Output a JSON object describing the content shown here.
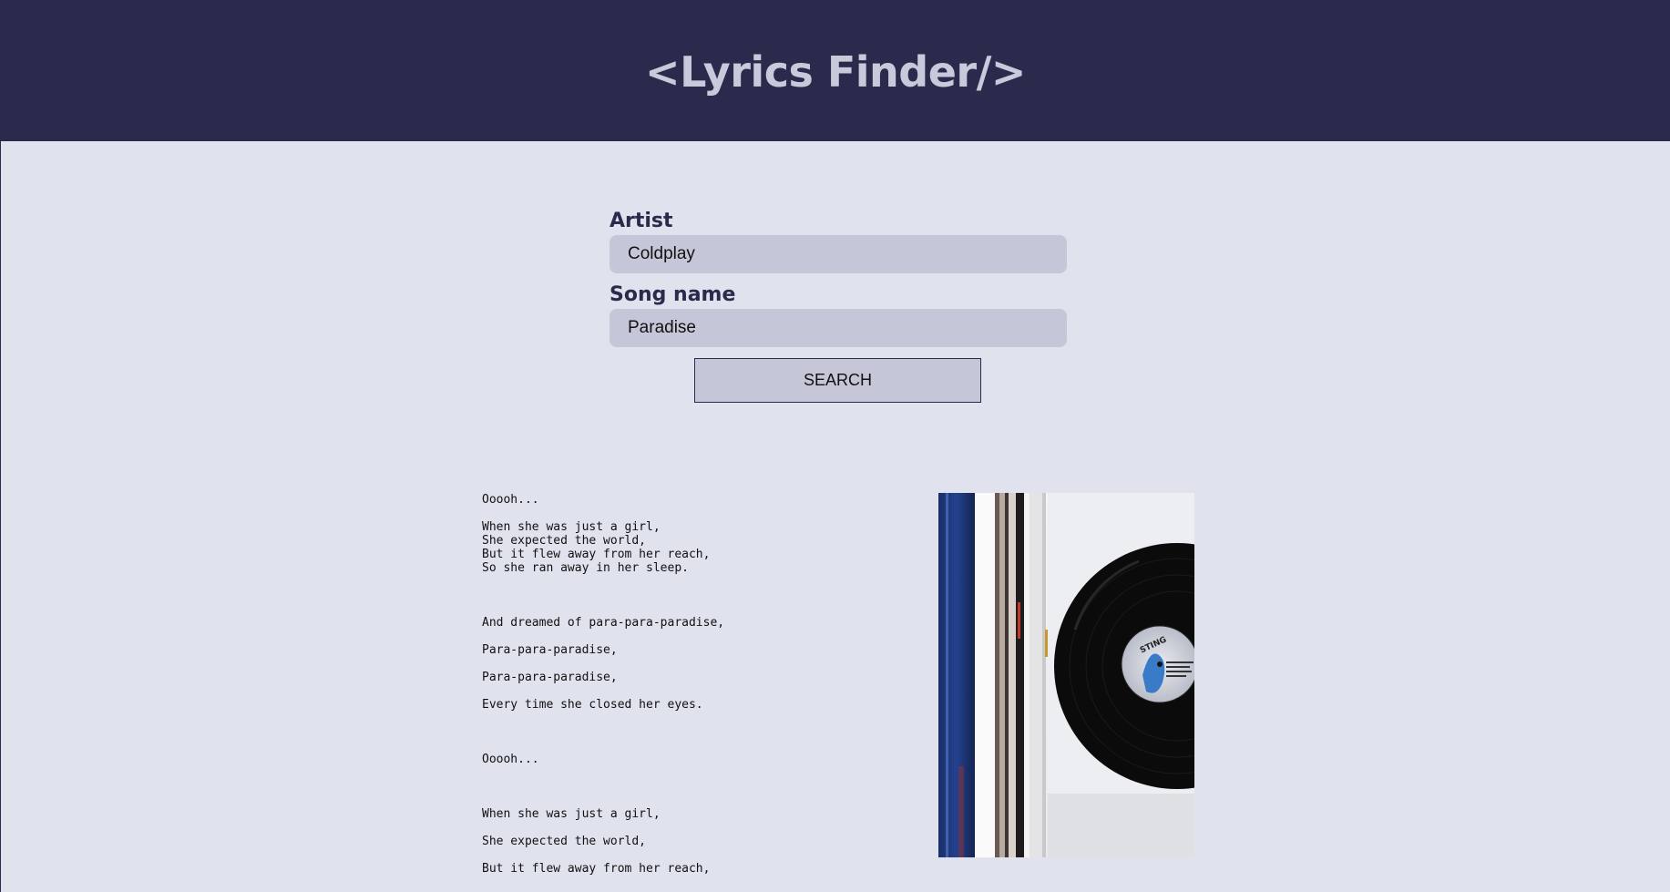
{
  "header": {
    "title": "<Lyrics Finder/>"
  },
  "form": {
    "artist_label": "Artist",
    "artist_value": "Coldplay",
    "song_label": "Song name",
    "song_value": "Paradise",
    "search_label": "SEARCH"
  },
  "lyrics": {
    "lines": [
      "Ooooh...",
      "",
      "When she was just a girl,",
      "She expected the world,",
      "But it flew away from her reach,",
      "So she ran away in her sleep.",
      "",
      "",
      "",
      "And dreamed of para-para-paradise,",
      "",
      "Para-para-paradise,",
      "",
      "Para-para-paradise,",
      "",
      "Every time she closed her eyes.",
      "",
      "",
      "",
      "Ooooh...",
      "",
      "",
      "",
      "When she was just a girl,",
      "",
      "She expected the world,",
      "",
      "But it flew away from her reach,"
    ]
  },
  "cover": {
    "label_text": "STING"
  },
  "colors": {
    "header_bg": "#2b2a4c",
    "page_bg": "#e0e2ee",
    "field_bg": "#c5c7d9",
    "title_color": "#c8cadb"
  }
}
